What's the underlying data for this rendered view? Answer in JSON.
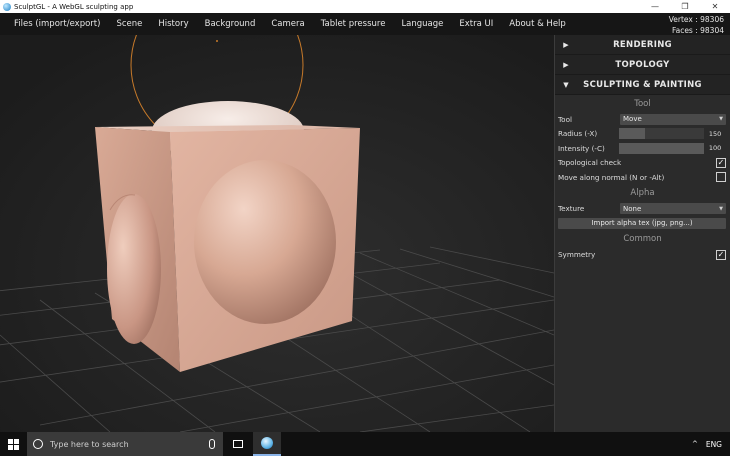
{
  "window": {
    "title": "SculptGL - A WebGL sculpting app",
    "controls": [
      "—",
      "❐",
      "✕"
    ]
  },
  "menu": [
    "Files (import/export)",
    "Scene",
    "History",
    "Background",
    "Camera",
    "Tablet pressure",
    "Language",
    "Extra UI",
    "About & Help"
  ],
  "stats": {
    "vertex": "Vertex : 98306",
    "faces": "Faces : 98304"
  },
  "panel": {
    "sections": [
      {
        "title": "RENDERING",
        "expanded": false
      },
      {
        "title": "TOPOLOGY",
        "expanded": false
      },
      {
        "title": "SCULPTING & PAINTING",
        "expanded": true
      }
    ],
    "tool_group": "Tool",
    "tool": {
      "label": "Tool",
      "value": "Move"
    },
    "radius": {
      "label": "Radius (-X)",
      "value": "150",
      "fraction": 0.3
    },
    "intensity": {
      "label": "Intensity (-C)",
      "value": "100",
      "fraction": 1.0
    },
    "topological_check": {
      "label": "Topological check",
      "checked": true
    },
    "move_along_normal": {
      "label": "Move along normal (N or -Alt)",
      "checked": false
    },
    "alpha_group": "Alpha",
    "texture": {
      "label": "Texture",
      "value": "None"
    },
    "import_alpha": "Import alpha tex (jpg, png...)",
    "common_group": "Common",
    "symmetry": {
      "label": "Symmetry",
      "checked": true
    }
  },
  "taskbar": {
    "search_placeholder": "Type here to search",
    "language": "ENG"
  },
  "colors": {
    "menubar_bg": "#161616",
    "viewport_bg": "#232323",
    "panel_bg": "#2b2b2b",
    "mesh_skin": "#d7a996",
    "brush_ring": "#c77a2a",
    "taskbar_bg": "#101010"
  },
  "icons": [
    "app-icon",
    "chevron-right-icon",
    "chevron-down-icon",
    "checkmark-icon",
    "windows-logo-icon",
    "search-icon",
    "microphone-icon",
    "task-view-icon",
    "sculptgl-app-icon",
    "chevron-up-icon"
  ]
}
